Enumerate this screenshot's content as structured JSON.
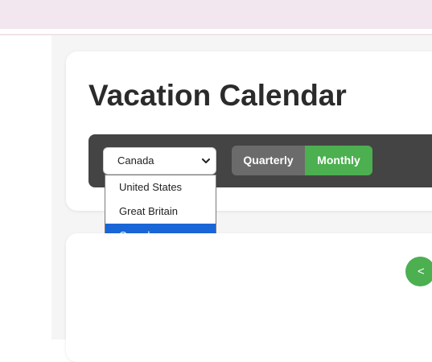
{
  "header": {
    "title": "Vacation Calendar"
  },
  "controls": {
    "country_select": {
      "value": "Canada",
      "options": [
        "United States",
        "Great Britain",
        "Canada"
      ],
      "selected_index": 2
    },
    "view_toggle": {
      "quarterly_label": "Quarterly",
      "monthly_label": "Monthly",
      "active": "Monthly"
    }
  },
  "calendar": {
    "prev_label": "<"
  },
  "colors": {
    "accent": "#4caf50",
    "toolbar": "#444444",
    "selected_option": "#1a66d6",
    "topbar": "#f2e6ef"
  },
  "icons": {
    "select_chevron": "chevron-down-icon"
  }
}
